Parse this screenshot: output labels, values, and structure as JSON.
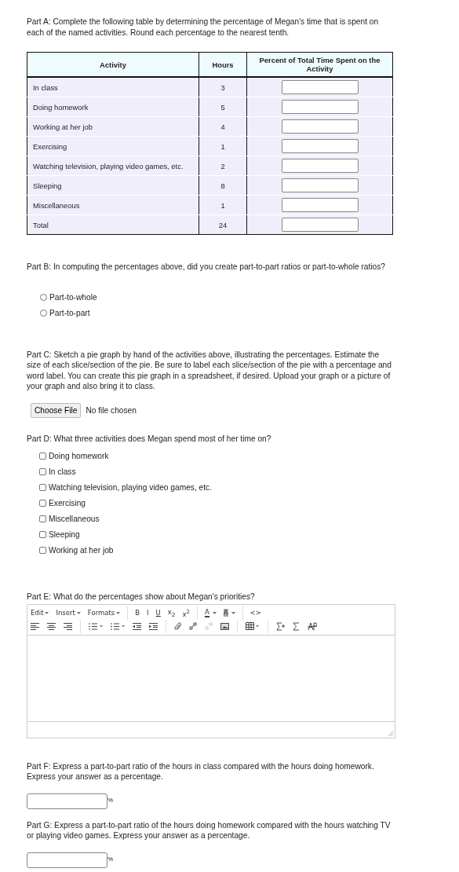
{
  "part_a": {
    "text": "Part A: Complete the following table by determining the percentage of Megan's time that is spent on each of the named activities. Round each percentage to the nearest tenth."
  },
  "table": {
    "columns": [
      "Activity",
      "Hours",
      "Percent of Total Time Spent on the Activity"
    ],
    "rows": [
      {
        "activity": "In class",
        "hours": "3",
        "kind": "input"
      },
      {
        "activity": "Doing homework",
        "hours": "5",
        "kind": "input"
      },
      {
        "activity": "Working at her job",
        "hours": "4",
        "kind": "input"
      },
      {
        "activity": "Exercising",
        "hours": "1",
        "kind": "input"
      },
      {
        "activity": "Watching television, playing video games, etc.",
        "hours": "2",
        "kind": "input"
      },
      {
        "activity": "Sleeping",
        "hours": "8",
        "kind": "input"
      },
      {
        "activity": "Miscellaneous",
        "hours": "1",
        "kind": "input"
      },
      {
        "activity": "Total",
        "hours": "24",
        "kind": "input"
      }
    ]
  },
  "part_b": {
    "text": "Part B: In computing the percentages above, did you create part-to-part ratios or part-to-whole ratios?",
    "options": [
      {
        "label": "Part-to-whole",
        "selected": false
      },
      {
        "label": "Part-to-part",
        "selected": false
      }
    ]
  },
  "part_c": {
    "text": "Part C: Sketch a pie graph by hand of the activities above, illustrating the percentages. Estimate the size of each slice/section of the pie. Be sure to label each slice/section of the pie with a percentage and word label. You can create this pie graph in a spreadsheet, if desired. Upload your graph or a picture of your graph and also bring it to class.",
    "file_button": "Choose File",
    "file_status": "No file chosen"
  },
  "part_d": {
    "text": "Part D: What three activities does Megan spend most of her time on?",
    "options": [
      {
        "label": "Doing homework",
        "checked": false
      },
      {
        "label": "In class",
        "checked": false
      },
      {
        "label": "Watching television, playing video games, etc.",
        "checked": false
      },
      {
        "label": "Exercising",
        "checked": false
      },
      {
        "label": "Miscellaneous",
        "checked": false
      },
      {
        "label": "Sleeping",
        "checked": false
      },
      {
        "label": "Working at her job",
        "checked": false
      }
    ]
  },
  "part_e": {
    "text": "Part E: What do the percentages show about Megan's priorities?",
    "menus": [
      "Edit",
      "Insert",
      "Formats"
    ],
    "format_buttons": [
      "B",
      "I",
      "U",
      "x$_{2}$",
      "x$^{2}$"
    ],
    "color_buttons": [
      "A",
      "A"
    ],
    "code_button": "<>"
  },
  "part_f": {
    "text": "Part F: Express a part-to-part ratio of the hours in class compared with the hours doing homework. Express your answer as a percentage.",
    "unit": "%"
  },
  "part_g": {
    "text": "Part G: Express a part-to-part ratio of the hours doing homework compared with the hours watching TV or playing video games. Express your answer as a percentage.",
    "unit": "%"
  }
}
